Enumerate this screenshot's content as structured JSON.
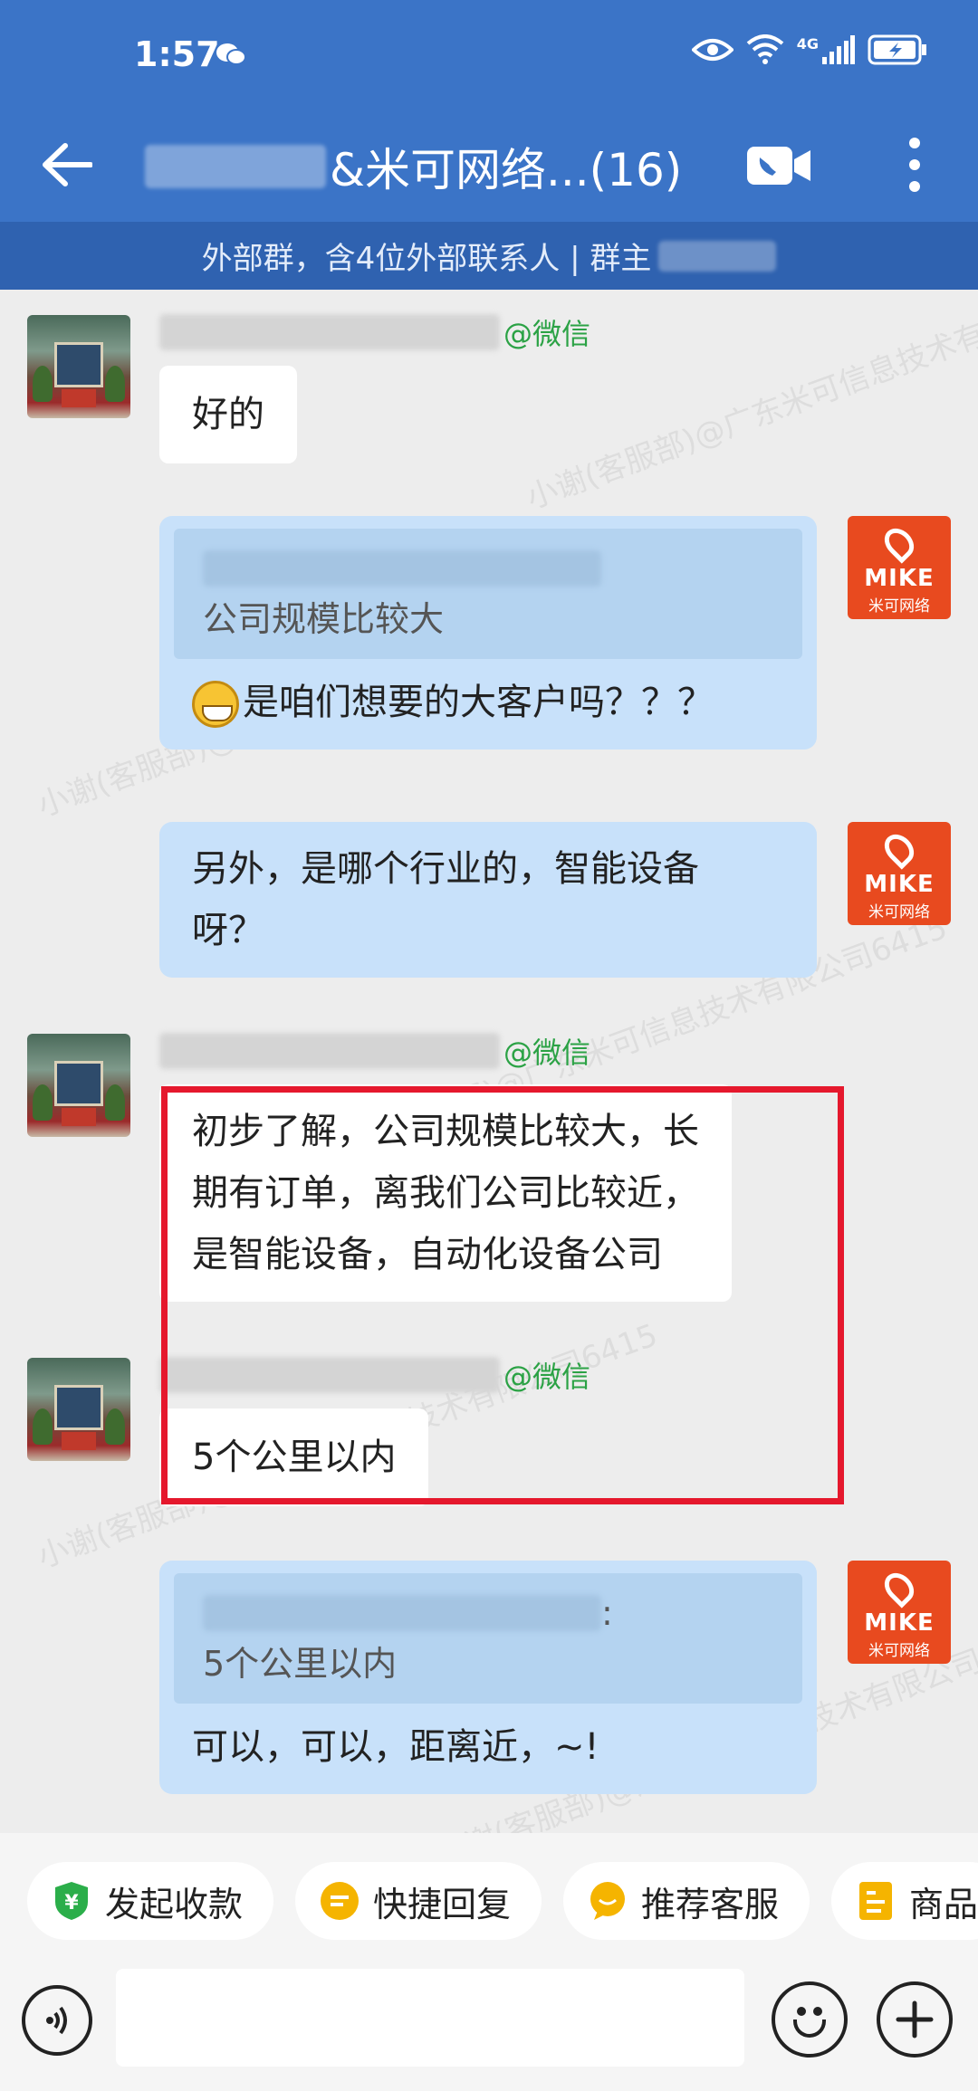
{
  "status_bar": {
    "time": "1:57",
    "network": "4G"
  },
  "header": {
    "title_suffix": "&米可网络...(16)",
    "subtitle": "外部群，含4位外部联系人 | 群主"
  },
  "messages": [
    {
      "side": "left",
      "source_tag": "@微信",
      "text": "好的"
    },
    {
      "side": "right",
      "quote_text": "公司规模比较大",
      "text": "是咱们想要的大客户吗？？？"
    },
    {
      "side": "right",
      "text_lines": [
        "另外，是哪个行业的，智能设备",
        "呀？"
      ]
    },
    {
      "side": "left",
      "source_tag": "@微信",
      "text_lines": [
        "初步了解，公司规模比较大，长",
        "期有订单，离我们公司比较近，",
        "是智能设备，自动化设备公司"
      ]
    },
    {
      "side": "left",
      "source_tag": "@微信",
      "text": "5个公里以内"
    },
    {
      "side": "right",
      "quote_suffix": ":",
      "quote_text": "5个公里以内",
      "text": "可以，可以，距离近，~!"
    }
  ],
  "right_avatar": {
    "brand": "MIKE",
    "brand_sub": "米可网络"
  },
  "watermarks": [
    "小谢(客服部)@广东米可信息技术有限公司6415"
  ],
  "quick_actions": [
    {
      "label": "发起收款",
      "icon": "payment-shield-icon",
      "color": "#2bae4a"
    },
    {
      "label": "快捷回复",
      "icon": "quick-reply-icon",
      "color": "#f5b400"
    },
    {
      "label": "推荐客服",
      "icon": "recommend-service-icon",
      "color": "#f5b400"
    },
    {
      "label": "商品",
      "icon": "product-icon",
      "color": "#f5b400"
    }
  ],
  "input": {
    "placeholder": ""
  },
  "colors": {
    "header": "#3b74c7",
    "subheader": "#2f62b0",
    "bubble_right": "#c8e1fa",
    "highlight": "#e5182d",
    "wechat_tag": "#2ba245"
  }
}
